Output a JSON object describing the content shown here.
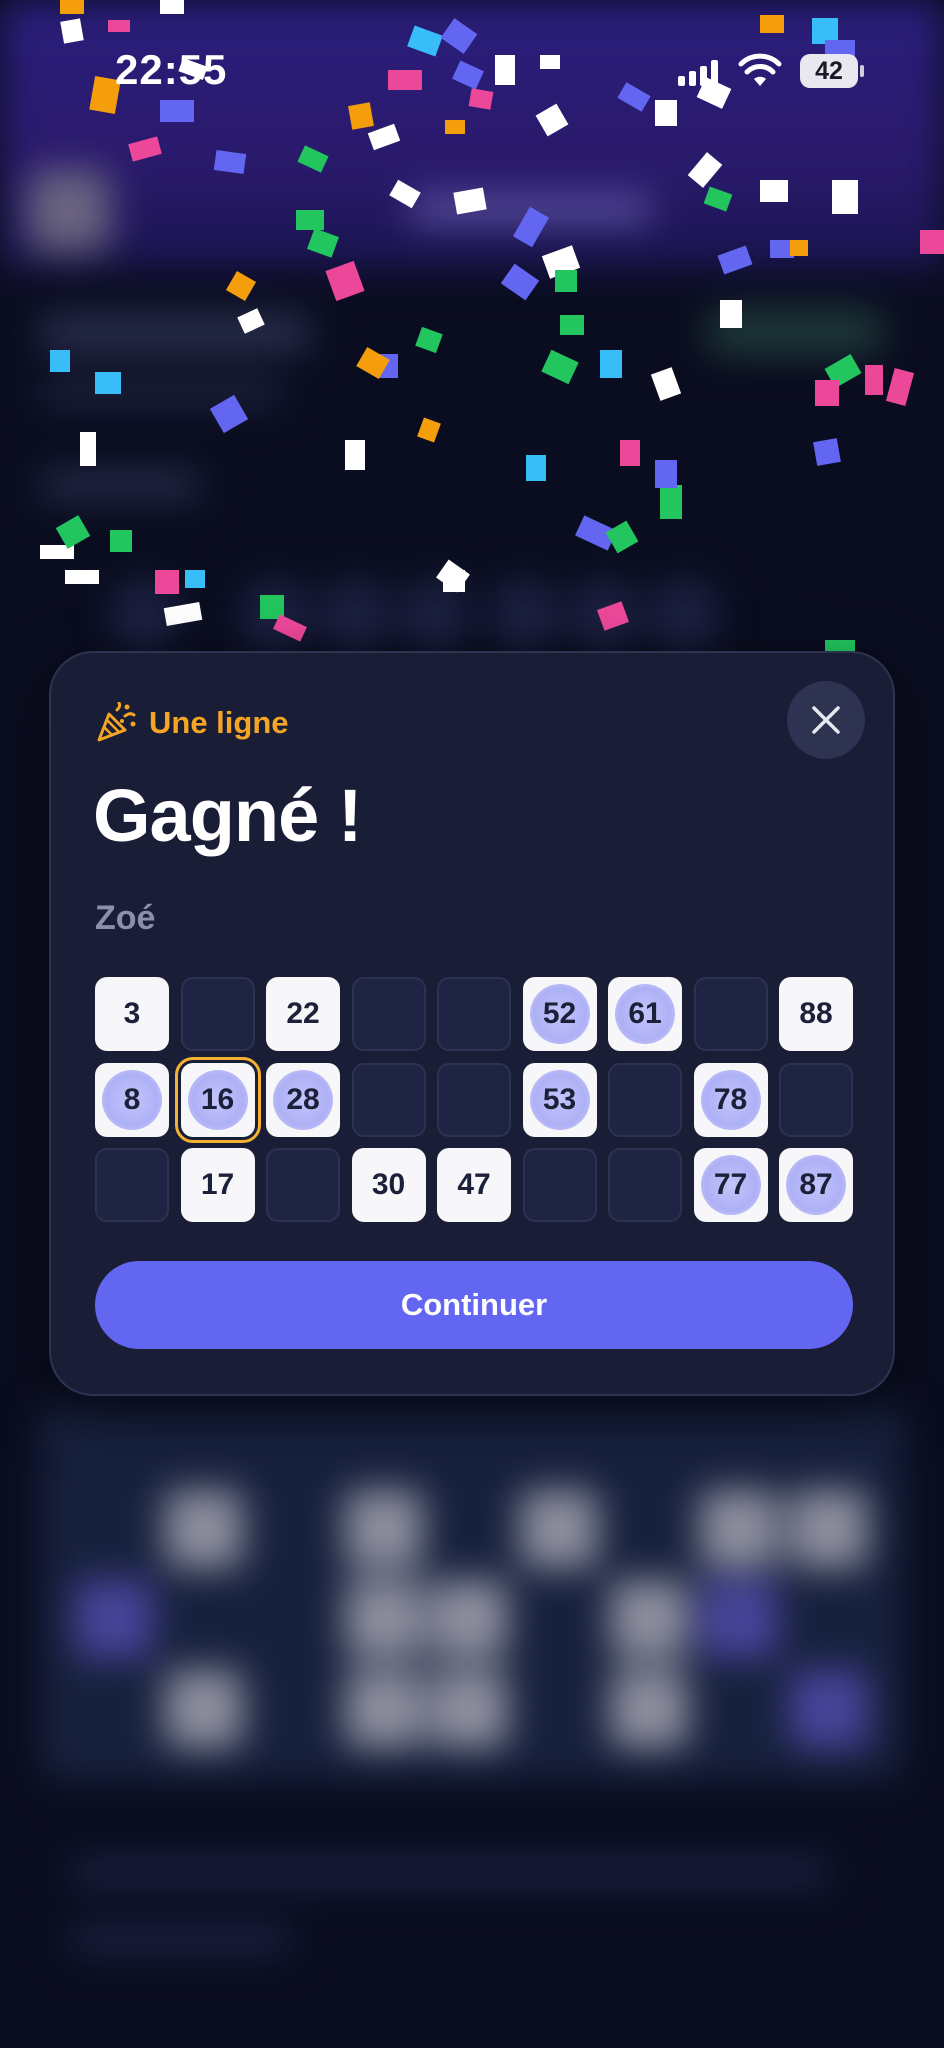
{
  "status_bar": {
    "time": "22:55",
    "battery": "42"
  },
  "modal": {
    "tag_icon": "party-popper-icon",
    "tag_label": "Une ligne",
    "title": "Gagné !",
    "player_name": "Zoé",
    "close_icon": "close-icon",
    "continue_label": "Continuer",
    "accent_color": "#f5a524",
    "button_color": "#6366f1",
    "ticket": [
      [
        {
          "value": "3",
          "marked": false
        },
        {
          "value": "",
          "marked": false
        },
        {
          "value": "22",
          "marked": false
        },
        {
          "value": "",
          "marked": false
        },
        {
          "value": "",
          "marked": false
        },
        {
          "value": "52",
          "marked": true
        },
        {
          "value": "61",
          "marked": true
        },
        {
          "value": "",
          "marked": false
        },
        {
          "value": "88",
          "marked": false
        }
      ],
      [
        {
          "value": "8",
          "marked": true
        },
        {
          "value": "16",
          "marked": true,
          "focused": true
        },
        {
          "value": "28",
          "marked": true
        },
        {
          "value": "",
          "marked": false
        },
        {
          "value": "",
          "marked": false
        },
        {
          "value": "53",
          "marked": true
        },
        {
          "value": "",
          "marked": false
        },
        {
          "value": "78",
          "marked": true
        },
        {
          "value": "",
          "marked": false
        }
      ],
      [
        {
          "value": "",
          "marked": false
        },
        {
          "value": "17",
          "marked": false
        },
        {
          "value": "",
          "marked": false
        },
        {
          "value": "30",
          "marked": false
        },
        {
          "value": "47",
          "marked": false
        },
        {
          "value": "",
          "marked": false
        },
        {
          "value": "",
          "marked": false
        },
        {
          "value": "77",
          "marked": true
        },
        {
          "value": "87",
          "marked": true
        }
      ]
    ]
  }
}
